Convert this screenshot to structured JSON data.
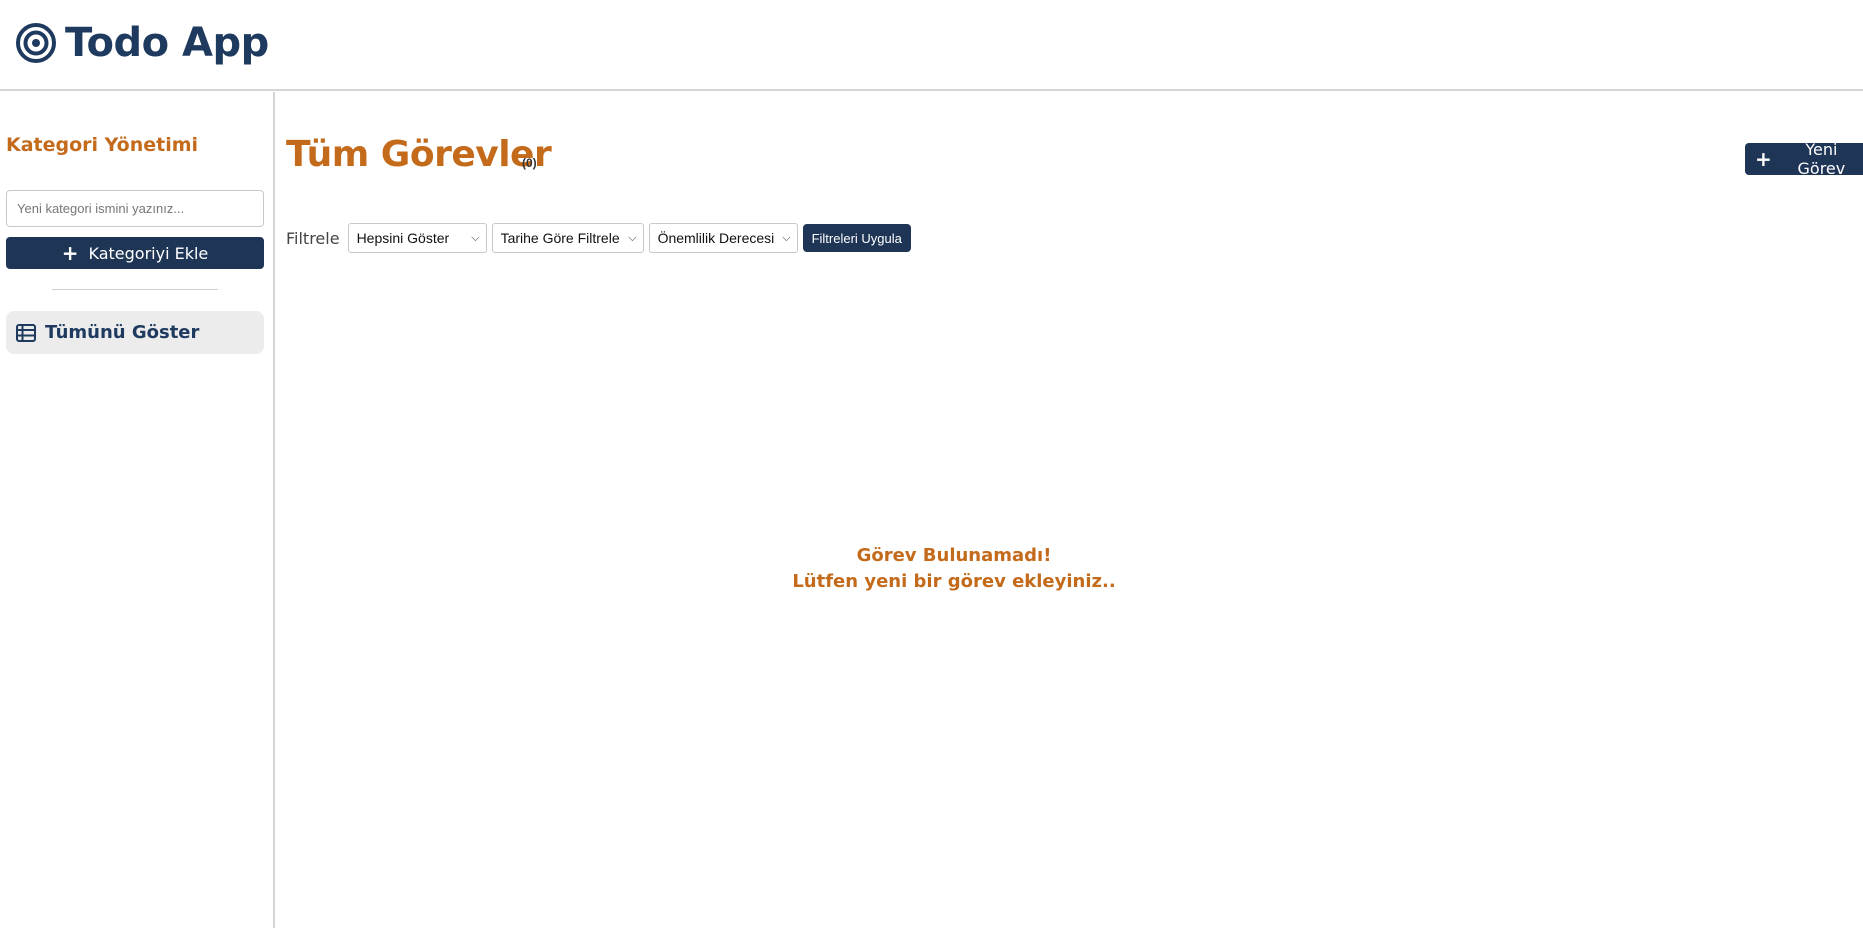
{
  "header": {
    "app_title": "Todo App",
    "logo_icon": "target-icon"
  },
  "sidebar": {
    "title": "Kategori Yönetimi",
    "category_input_placeholder": "Yeni kategori ismini yazınız...",
    "add_category_label": "Kategoriyi Ekle",
    "items": [
      {
        "label": "Tümünü Göster",
        "icon": "table-list-icon"
      }
    ]
  },
  "main": {
    "title": "Tüm Görevler",
    "task_count": "(0)",
    "new_task_label": "Yeni Görev",
    "filter": {
      "label": "Filtrele",
      "status_select": "Hepsini Göster",
      "date_select": "Tarihe Göre Filtrele",
      "priority_select": "Önemlilik Derecesi",
      "apply_label": "Filtreleri Uygula"
    },
    "empty_state": {
      "line1": "Görev Bulunamadı!",
      "line2": "Lütfen yeni bir görev ekleyiniz.."
    }
  },
  "colors": {
    "primary": "#1f3556",
    "accent": "#c46a1b",
    "sidebar_item_bg": "#ececec",
    "border": "#d6d6d6"
  }
}
